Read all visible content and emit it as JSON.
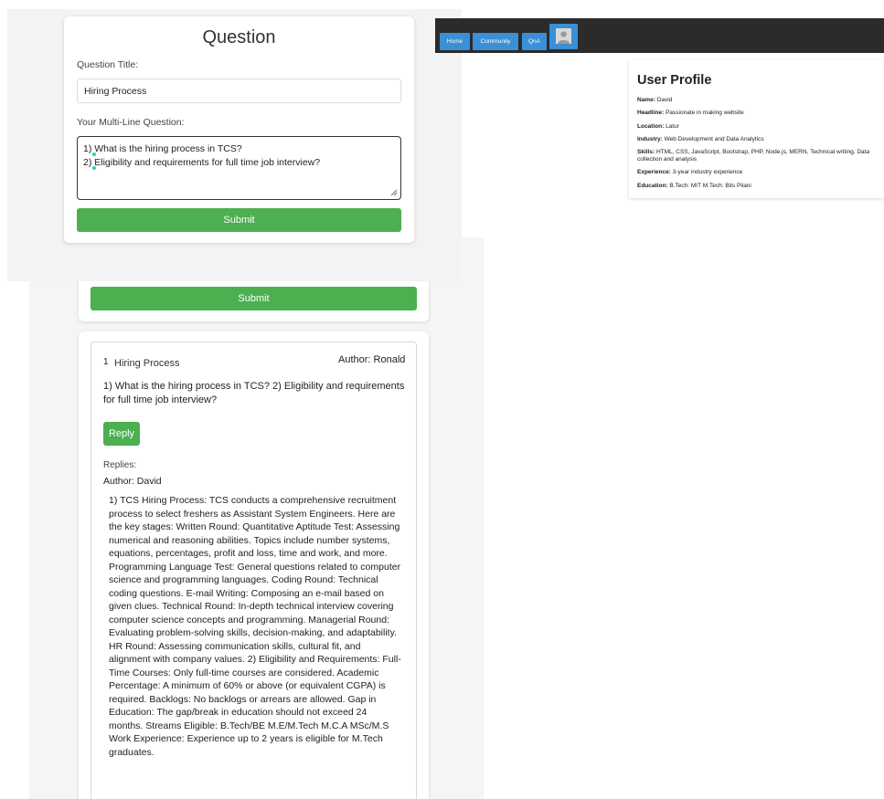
{
  "question_form": {
    "heading": "Question",
    "title_label": "Question Title:",
    "title_value": "Hiring Process",
    "multiline_label": "Your Multi-Line Question:",
    "multiline_lines": [
      "1) What is the hiring process in TCS?",
      "2) Eligibility and requirements for full time job interview?"
    ],
    "submit_label": "Submit"
  },
  "background_form": {
    "submit_label": "Submit"
  },
  "post": {
    "number": "1",
    "title": "Hiring Process",
    "author": "Author: Ronald",
    "body": "1) What is the hiring process in TCS? 2) Eligibility and requirements for full time job interview?",
    "reply_label": "Reply",
    "replies_label": "Replies:",
    "reply": {
      "author": "Author: David",
      "text": "1) TCS Hiring Process: TCS conducts a comprehensive recruitment process to select freshers as Assistant System Engineers. Here are the key stages: Written Round: Quantitative Aptitude Test: Assessing numerical and reasoning abilities. Topics include number systems, equations, percentages, profit and loss, time and work, and more. Programming Language Test: General questions related to computer science and programming languages. Coding Round: Technical coding questions. E-mail Writing: Composing an e-mail based on given clues. Technical Round: In-depth technical interview covering computer science concepts and programming. Managerial Round: Evaluating problem-solving skills, decision-making, and adaptability. HR Round: Assessing communication skills, cultural fit, and alignment with company values. 2) Eligibility and Requirements: Full-Time Courses: Only full-time courses are considered. Academic Percentage: A minimum of 60% or above (or equivalent CGPA) is required. Backlogs: No backlogs or arrears are allowed. Gap in Education: The gap/break in education should not exceed 24 months. Streams Eligible: B.Tech/BE M.E/M.Tech M.C.A MSc/M.S Work Experience: Experience up to 2 years is eligible for M.Tech graduates."
    }
  },
  "nav": {
    "items": [
      "Home",
      "Community",
      "QnA"
    ],
    "avatar_icon": "user-avatar-icon"
  },
  "profile": {
    "title": "User Profile",
    "fields": [
      {
        "label": "Name:",
        "value": "David"
      },
      {
        "label": "Headline:",
        "value": "Passionate in making website"
      },
      {
        "label": "Location:",
        "value": "Latur"
      },
      {
        "label": "Industry:",
        "value": "Web Development and Data Analytics"
      },
      {
        "label": "Skills:",
        "value": "HTML, CSS, JavaScript, Bootstrap, PHP, Node.js, MERN, Technical writing, Data collection and analysis"
      },
      {
        "label": "Experience:",
        "value": "3-year industry experience"
      },
      {
        "label": "Education:",
        "value": "B.Tech: MIT M.Tech: Bits Pilani"
      }
    ]
  },
  "colors": {
    "accent_green": "#4caf50",
    "nav_blue": "#3a8fd6",
    "nav_dark": "#2b2b2b"
  }
}
